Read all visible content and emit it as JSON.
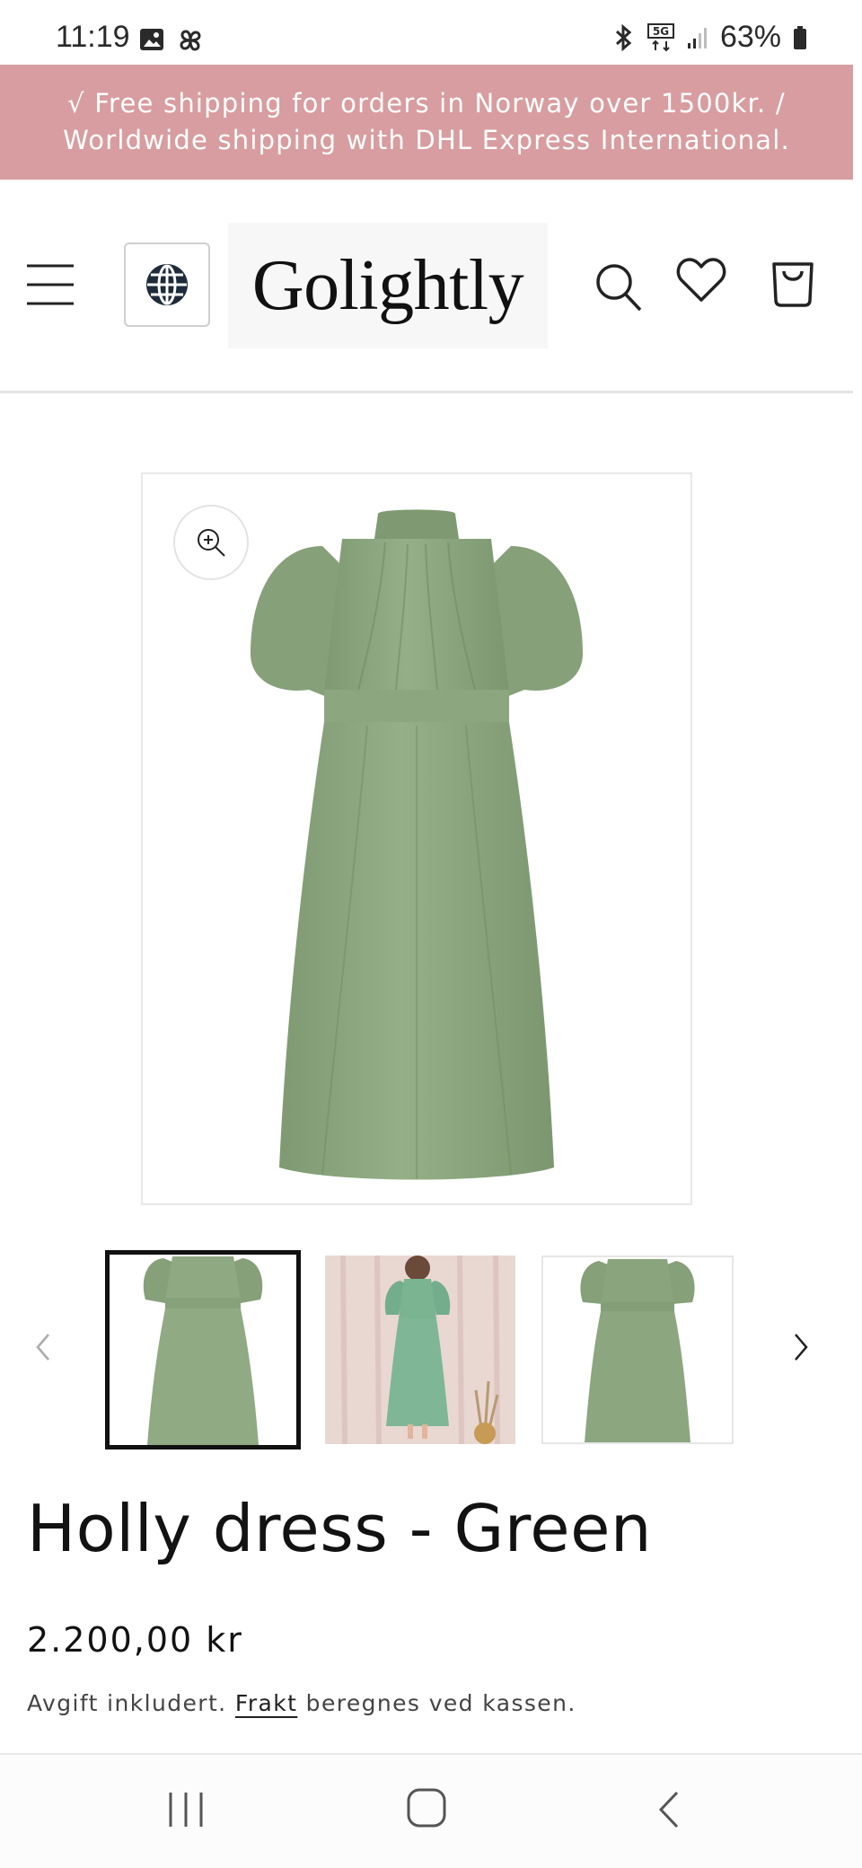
{
  "status_bar": {
    "time": "11:19",
    "battery": "63%",
    "network": "5G"
  },
  "announcement": {
    "line1": "√ Free shipping for orders in Norway over 1500kr. /",
    "line2": "Worldwide shipping with DHL Express International."
  },
  "header": {
    "logo": "Golightly"
  },
  "product": {
    "title": "Holly dress - Green",
    "price": "2.200,00 kr",
    "tax_prefix": "Avgift inkludert.",
    "shipping_link": "Frakt",
    "tax_suffix": "beregnes ved kassen."
  },
  "colors": {
    "announcement_bg": "#d89da0",
    "dress_green": "#8aa57d"
  },
  "icons": [
    "menu-icon",
    "globe-icon",
    "search-icon",
    "heart-icon",
    "cart-icon",
    "zoom-icon",
    "chevron-left-icon",
    "chevron-right-icon",
    "recent-apps-icon",
    "home-icon",
    "back-icon"
  ]
}
